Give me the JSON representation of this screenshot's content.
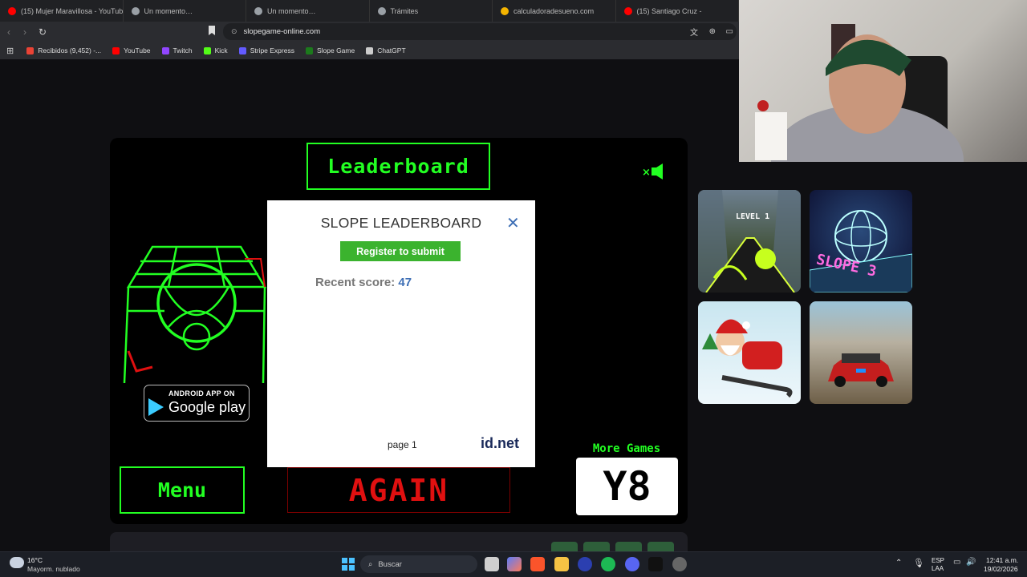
{
  "browser": {
    "tabs": [
      {
        "title": "(15) Mujer Maravillosa - YouTube",
        "color": "#ff0000"
      },
      {
        "title": "Un momento…",
        "color": "#9aa0a6"
      },
      {
        "title": "Un momento…",
        "color": "#9aa0a6"
      },
      {
        "title": "Trámites",
        "color": "#9aa0a6"
      },
      {
        "title": "calculadoradesueno.com",
        "color": "#f4b400"
      },
      {
        "title": "(15) Santiago Cruz -",
        "color": "#ff0000"
      }
    ],
    "url": "slopegame-online.com",
    "bookmarks": [
      {
        "label": "Recibidos (9,452) -...",
        "color": "#ea4335"
      },
      {
        "label": "YouTube",
        "color": "#ff0000"
      },
      {
        "label": "Twitch",
        "color": "#9146ff"
      },
      {
        "label": "Kick",
        "color": "#53fc18"
      },
      {
        "label": "Stripe Express",
        "color": "#635bff"
      },
      {
        "label": "Slope Game",
        "color": "#1c7a1c"
      },
      {
        "label": "ChatGPT",
        "color": "#cccccc"
      }
    ]
  },
  "game": {
    "leaderboard_label": "Leaderboard",
    "menu_label": "Menu",
    "again_label": "AGAIN",
    "more_games_label": "More Games",
    "y8_label": "Y8",
    "google_play": {
      "top": "ANDROID APP ON",
      "bottom": "Google play"
    }
  },
  "modal": {
    "title": "SLOPE LEADERBOARD",
    "close": "✕",
    "register_label": "Register to submit",
    "recent_label": "Recent score:",
    "recent_value": "47",
    "page_label": "page 1",
    "brand": "id.net"
  },
  "thumbnails": [
    {
      "name": "level-1",
      "text": "LEVEL 1"
    },
    {
      "name": "slope-3",
      "text": "SLOPE 3"
    },
    {
      "name": "santa-sled",
      "text": ""
    },
    {
      "name": "car-racing",
      "text": ""
    }
  ],
  "taskbar": {
    "weather_temp": "16°C",
    "weather_desc": "Mayorm. nublado",
    "search_label": "Buscar",
    "lang_top": "ESP",
    "lang_bottom": "LAA",
    "time": "12:41 a.m.",
    "date": "19/02/2026"
  }
}
